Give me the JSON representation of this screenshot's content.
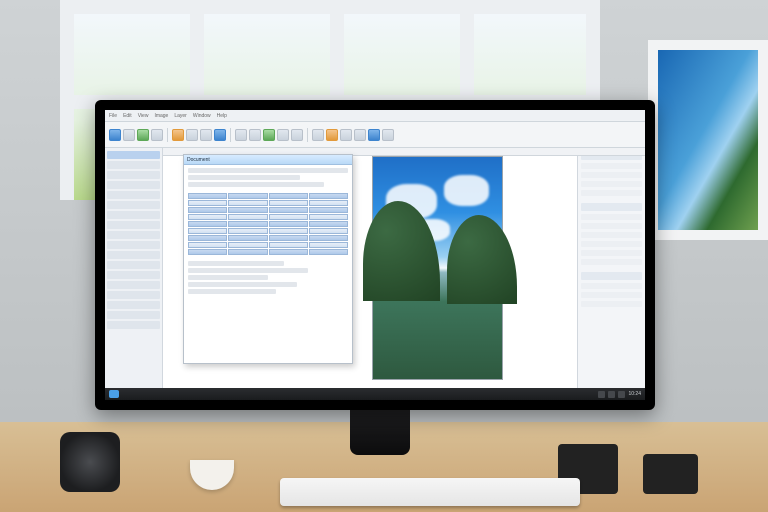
{
  "scene": {
    "description": "photo-desk-ultrawide-monitor"
  },
  "screen": {
    "menubar": [
      "File",
      "Edit",
      "View",
      "Image",
      "Layer",
      "Window",
      "Help"
    ],
    "sub_window": {
      "title": "Document"
    },
    "taskbar": {
      "clock": "10:24"
    }
  }
}
